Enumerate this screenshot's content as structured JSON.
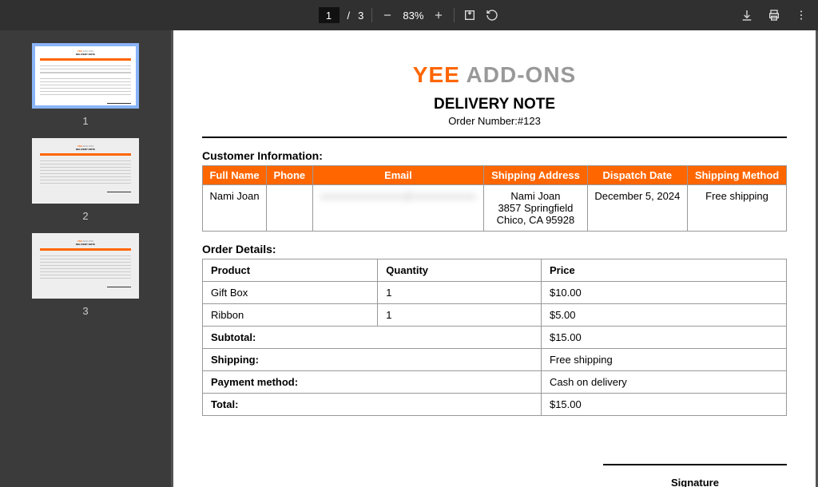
{
  "viewer": {
    "current_page": "1",
    "total_pages": "3",
    "zoom": "83%"
  },
  "thumbnails": [
    "1",
    "2",
    "3"
  ],
  "doc": {
    "logo_part1": "YEE",
    "logo_part2": "ADD-ONS",
    "title": "DELIVERY NOTE",
    "order_number": "Order Number:#123",
    "customer_section": "Customer Information:",
    "customer_headers": {
      "full_name": "Full Name",
      "phone": "Phone",
      "email": "Email",
      "shipping_address": "Shipping Address",
      "dispatch_date": "Dispatch Date",
      "shipping_method": "Shipping Method"
    },
    "customer": {
      "full_name": "Nami Joan",
      "phone": "",
      "email": "xxxxxxxxxxxxxxxx@xxxxxxxxxxxx",
      "address_line1": "Nami Joan",
      "address_line2": "3857 Springfield",
      "address_line3": "Chico, CA 95928",
      "dispatch_date": "December 5, 2024",
      "shipping_method": "Free shipping"
    },
    "order_section": "Order Details:",
    "order_headers": {
      "product": "Product",
      "quantity": "Quantity",
      "price": "Price"
    },
    "items": [
      {
        "product": "Gift Box",
        "quantity": "1",
        "price": "$10.00"
      },
      {
        "product": "Ribbon",
        "quantity": "1",
        "price": "$5.00"
      }
    ],
    "summary": {
      "subtotal_label": "Subtotal:",
      "subtotal": "$15.00",
      "shipping_label": "Shipping:",
      "shipping": "Free shipping",
      "payment_label": "Payment method:",
      "payment": "Cash on delivery",
      "total_label": "Total:",
      "total": "$15.00"
    },
    "signature": "Signature"
  }
}
